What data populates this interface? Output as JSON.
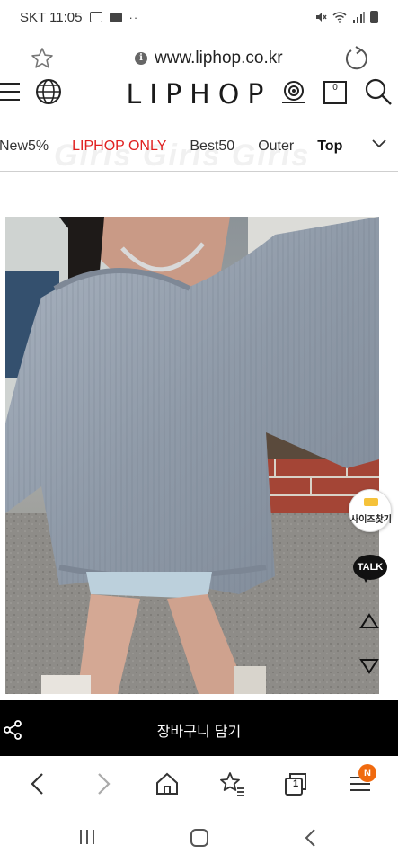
{
  "status_bar": {
    "carrier_time": "SKT 11:05",
    "dots": "··"
  },
  "browser": {
    "url": "www.liphop.co.kr",
    "info_glyph": "i"
  },
  "site": {
    "logo": "LIPHOP",
    "cart_count": "0"
  },
  "category_nav": {
    "items": [
      {
        "label": "New5%",
        "style": "normal"
      },
      {
        "label": "LIPHOP ONLY",
        "style": "red",
        "color": "#e02020"
      },
      {
        "label": "Best50",
        "style": "normal"
      },
      {
        "label": "Outer",
        "style": "normal"
      },
      {
        "label": "Top",
        "style": "bold"
      }
    ],
    "partial_item": "B",
    "background_text": "Girls Girls Girls"
  },
  "product": {
    "photo_alt": "knit sweater product photo"
  },
  "floating": {
    "size_finder_label": "사이즈찾기",
    "talk_label": "TALK"
  },
  "cart_bar": {
    "label": "장바구니 담기"
  },
  "browser_nav": {
    "tab_count": "1",
    "notification_badge": "N",
    "badge_color": "#f06a0f"
  },
  "icons": {
    "status": [
      "gallery-icon",
      "message-icon",
      "mute-icon",
      "wifi-icon",
      "signal-icon",
      "battery-icon"
    ],
    "url_bar": [
      "star-icon",
      "info-icon",
      "reload-icon"
    ],
    "header": [
      "menu-icon",
      "globe-icon",
      "camera-icon",
      "bag-icon",
      "search-icon"
    ],
    "nav": [
      "back-icon",
      "forward-icon",
      "home-icon",
      "bookmarks-icon",
      "tabs-icon",
      "menu-icon"
    ],
    "system": [
      "recent-apps-icon",
      "home-button-icon",
      "system-back-icon"
    ]
  }
}
